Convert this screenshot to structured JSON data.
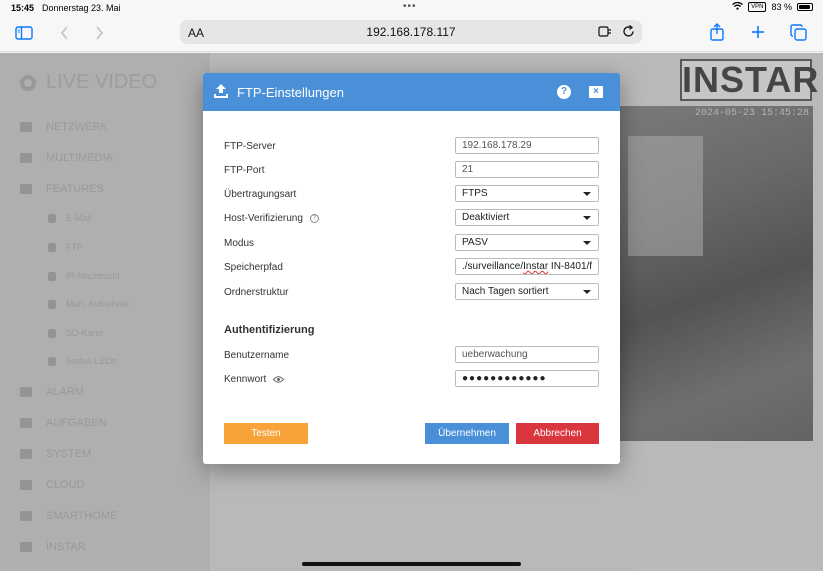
{
  "status_bar": {
    "time": "15:45",
    "date": "Donnerstag 23. Mai",
    "vpn": "VPN",
    "battery": "83 %"
  },
  "browser": {
    "aa_label": "AA",
    "url": "192.168.178.117"
  },
  "background_page": {
    "title": "LIVE VIDEO",
    "logo": "INSTAR",
    "camera_timestamp": "2024-05-23 15:45:28",
    "nav": [
      "NETZWERK",
      "MULTIMEDIA",
      "FEATURES",
      "E-Mail",
      "FTP",
      "IR-Nachtsicht",
      "Man. Aufnahme",
      "SD-Karte",
      "Status-LEDs",
      "ALARM",
      "AUFGABEN",
      "SYSTEM",
      "CLOUD",
      "SMARTHOME",
      "INSTAR"
    ]
  },
  "dialog": {
    "title": "FTP-Einstellungen",
    "help_label": "?",
    "close_label": "×",
    "fields": {
      "server": {
        "label": "FTP-Server",
        "placeholder": "192.168.178.29"
      },
      "port": {
        "label": "FTP-Port",
        "placeholder": "21"
      },
      "transfer": {
        "label": "Übertragungsart",
        "value": "FTPS"
      },
      "host_verify": {
        "label": "Host-Verifizierung",
        "value": "Deaktiviert"
      },
      "mode": {
        "label": "Modus",
        "value": "PASV"
      },
      "path": {
        "label": "Speicherpfad",
        "value_prefix": "./surveillance/",
        "value_spell": "Instar",
        "value_suffix": " IN-8401/f"
      },
      "folder": {
        "label": "Ordnerstruktur",
        "value": "Nach Tagen sortiert"
      }
    },
    "auth": {
      "section_title": "Authentifizierung",
      "username": {
        "label": "Benutzername",
        "placeholder": "ueberwachung"
      },
      "password": {
        "label": "Kennwort",
        "value": "●●●●●●●●●●●●"
      }
    },
    "buttons": {
      "test": "Testen",
      "apply": "Übernehmen",
      "cancel": "Abbrechen"
    }
  },
  "colors": {
    "header_blue": "#4a90d9",
    "test_orange": "#f8a33a",
    "cancel_red": "#d9363e",
    "safari_blue": "#0a7aff"
  }
}
